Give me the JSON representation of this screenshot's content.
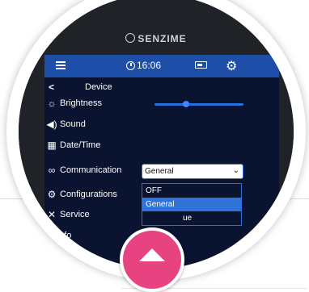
{
  "device": {
    "brand": "SENZIME",
    "time": "16:06"
  },
  "menu": {
    "title": "Device",
    "items": [
      {
        "label": "Brightness",
        "icon": "sun-icon"
      },
      {
        "label": "Sound",
        "icon": "speaker-icon"
      },
      {
        "label": "Date/Time",
        "icon": "calendar-icon"
      },
      {
        "label": "Communication",
        "icon": "link-icon"
      },
      {
        "label": "Configurations",
        "icon": "configurations-icon"
      },
      {
        "label": "Service",
        "icon": "tools-icon"
      },
      {
        "label": "Info",
        "icon": "info-icon"
      }
    ]
  },
  "brightness": {
    "level": 0.35
  },
  "communication": {
    "selected": "General",
    "options": [
      "OFF",
      "General",
      "ue"
    ],
    "highlighted": "General"
  },
  "colors": {
    "screen_background": "#0a1431",
    "header_blue": "#1e4fa8",
    "accent_blue": "#2f73d8",
    "up_button_pink": "#e74380"
  },
  "up_button": {
    "icon": "up-arrow-icon"
  }
}
